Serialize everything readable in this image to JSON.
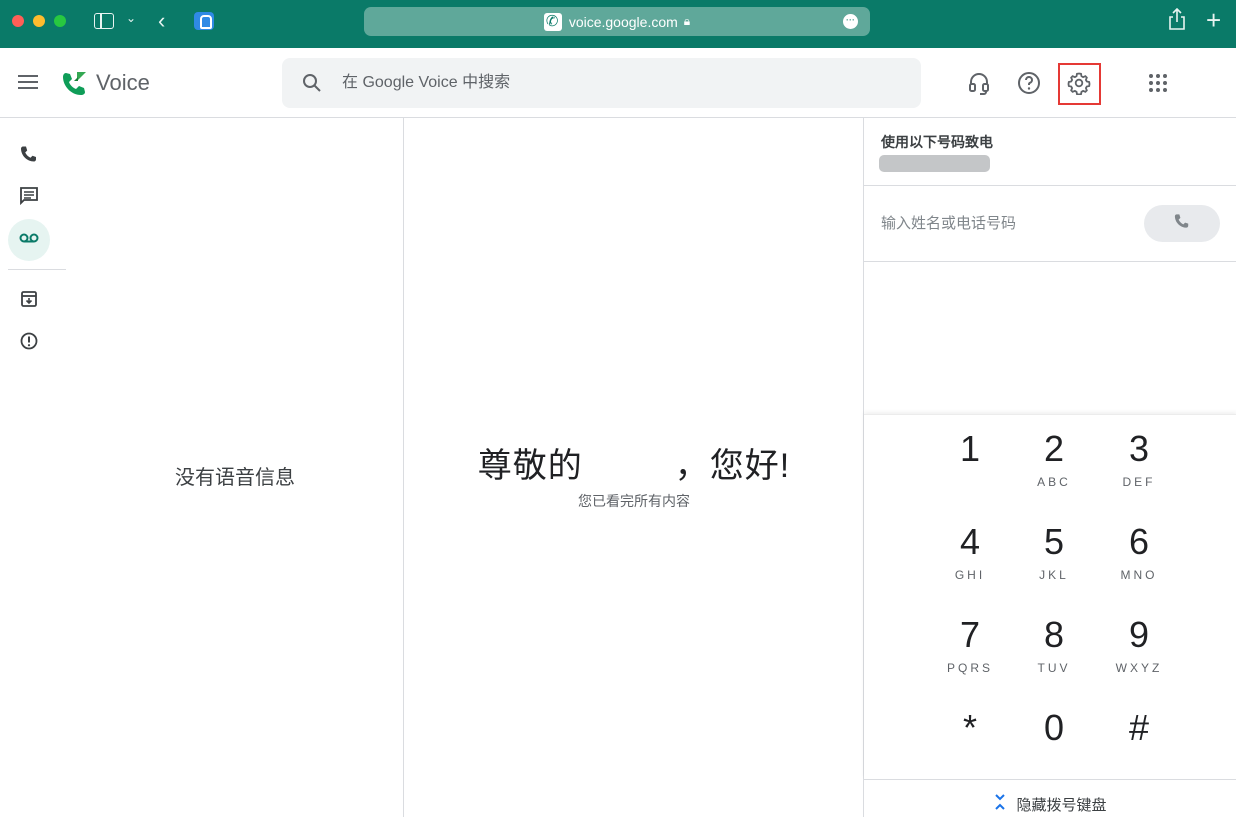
{
  "browser": {
    "url": "voice.google.com",
    "icons": [
      "sidebar-icon",
      "chevron-down-icon",
      "back-icon",
      "extension-icon",
      "lock-icon",
      "more-icon",
      "share-icon",
      "new-tab-icon"
    ]
  },
  "header": {
    "app_name": "Voice",
    "search_placeholder": "在 Google Voice 中搜索",
    "icons": [
      "menu-icon",
      "voice-logo-icon",
      "search-icon",
      "headset-icon",
      "help-icon",
      "settings-icon",
      "apps-grid-icon"
    ]
  },
  "nav": {
    "items": [
      {
        "name": "calls",
        "icon": "phone-icon",
        "active": false
      },
      {
        "name": "messages",
        "icon": "message-icon",
        "active": false
      },
      {
        "name": "voicemail",
        "icon": "voicemail-icon",
        "active": true
      },
      {
        "name": "archive",
        "icon": "archive-icon",
        "active": false
      },
      {
        "name": "spam",
        "icon": "spam-icon",
        "active": false
      }
    ],
    "accent": "#0a7a68",
    "active_bg": "#e6f4f1"
  },
  "list": {
    "empty_text": "没有语音信息"
  },
  "main": {
    "greeting_prefix": "尊敬的",
    "greeting_suffix": "，您好!",
    "subtext": "您已看完所有内容"
  },
  "dialer": {
    "call_from_label": "使用以下号码致电",
    "input_placeholder": "输入姓名或电话号码",
    "keys": [
      {
        "digit": "1",
        "letters": ""
      },
      {
        "digit": "2",
        "letters": "ABC"
      },
      {
        "digit": "3",
        "letters": "DEF"
      },
      {
        "digit": "4",
        "letters": "GHI"
      },
      {
        "digit": "5",
        "letters": "JKL"
      },
      {
        "digit": "6",
        "letters": "MNO"
      },
      {
        "digit": "7",
        "letters": "PQRS"
      },
      {
        "digit": "8",
        "letters": "TUV"
      },
      {
        "digit": "9",
        "letters": "WXYZ"
      },
      {
        "digit": "*",
        "letters": ""
      },
      {
        "digit": "0",
        "letters": ""
      },
      {
        "digit": "#",
        "letters": ""
      }
    ],
    "hide_label": "隐藏拨号键盘"
  },
  "colors": {
    "browser_bar": "#0a7a68",
    "highlight": "#e53935",
    "link": "#1a73e8"
  }
}
